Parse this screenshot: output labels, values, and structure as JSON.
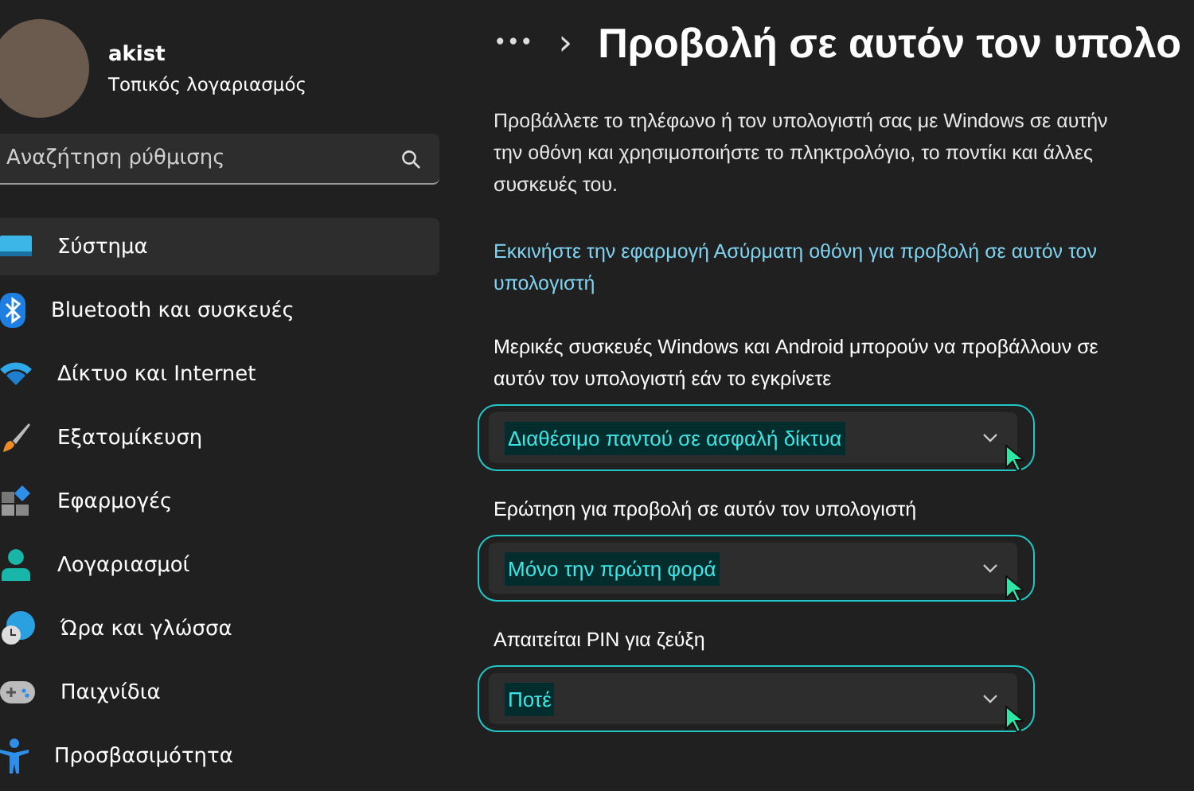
{
  "account": {
    "name": "akist",
    "type": "Τοπικός λογαριασμός"
  },
  "search": {
    "placeholder": "Αναζήτηση ρύθμισης"
  },
  "nav": [
    {
      "label": "Σύστημα",
      "kind": "system",
      "selected": true
    },
    {
      "label": "Bluetooth και συσκευές",
      "kind": "bluetooth",
      "selected": false
    },
    {
      "label": "Δίκτυο και Internet",
      "kind": "network",
      "selected": false
    },
    {
      "label": "Εξατομίκευση",
      "kind": "brush",
      "selected": false
    },
    {
      "label": "Εφαρμογές",
      "kind": "apps",
      "selected": false
    },
    {
      "label": "Λογαριασμοί",
      "kind": "person",
      "selected": false
    },
    {
      "label": "Ώρα και γλώσσα",
      "kind": "clock",
      "selected": false
    },
    {
      "label": "Παιχνίδια",
      "kind": "gamepad",
      "selected": false
    },
    {
      "label": "Προσβασιμότητα",
      "kind": "accessibility",
      "selected": false
    }
  ],
  "breadcrumb": {
    "more": "•••",
    "separator": "›",
    "title": "Προβολή σε αυτόν τον υπολο"
  },
  "description": "Προβάλλετε το τηλέφωνο ή τον υπολογιστή σας με Windows σε αυτήν την οθόνη και χρησιμοποιήστε το πληκτρολόγιο, το ποντίκι και άλλες συσκευές του.",
  "link": "Εκκινήστε την εφαρμογή Ασύρματη οθόνη για προβολή σε αυτόν τον υπολογιστή",
  "settings": [
    {
      "label": "Μερικές συσκευές Windows και Android μπορούν να προβάλλουν σε αυτόν τον υπολογιστή εάν το εγκρίνετε",
      "value": "Διαθέσιμο παντού σε ασφαλή δίκτυα",
      "highlighted": true
    },
    {
      "label": "Ερώτηση για προβολή σε αυτόν τον υπολογιστή",
      "value": "Μόνο την πρώτη φορά",
      "highlighted": true
    },
    {
      "label": "Απαιτείται PIN για ζεύξη",
      "value": "Ποτέ",
      "highlighted": true
    }
  ]
}
